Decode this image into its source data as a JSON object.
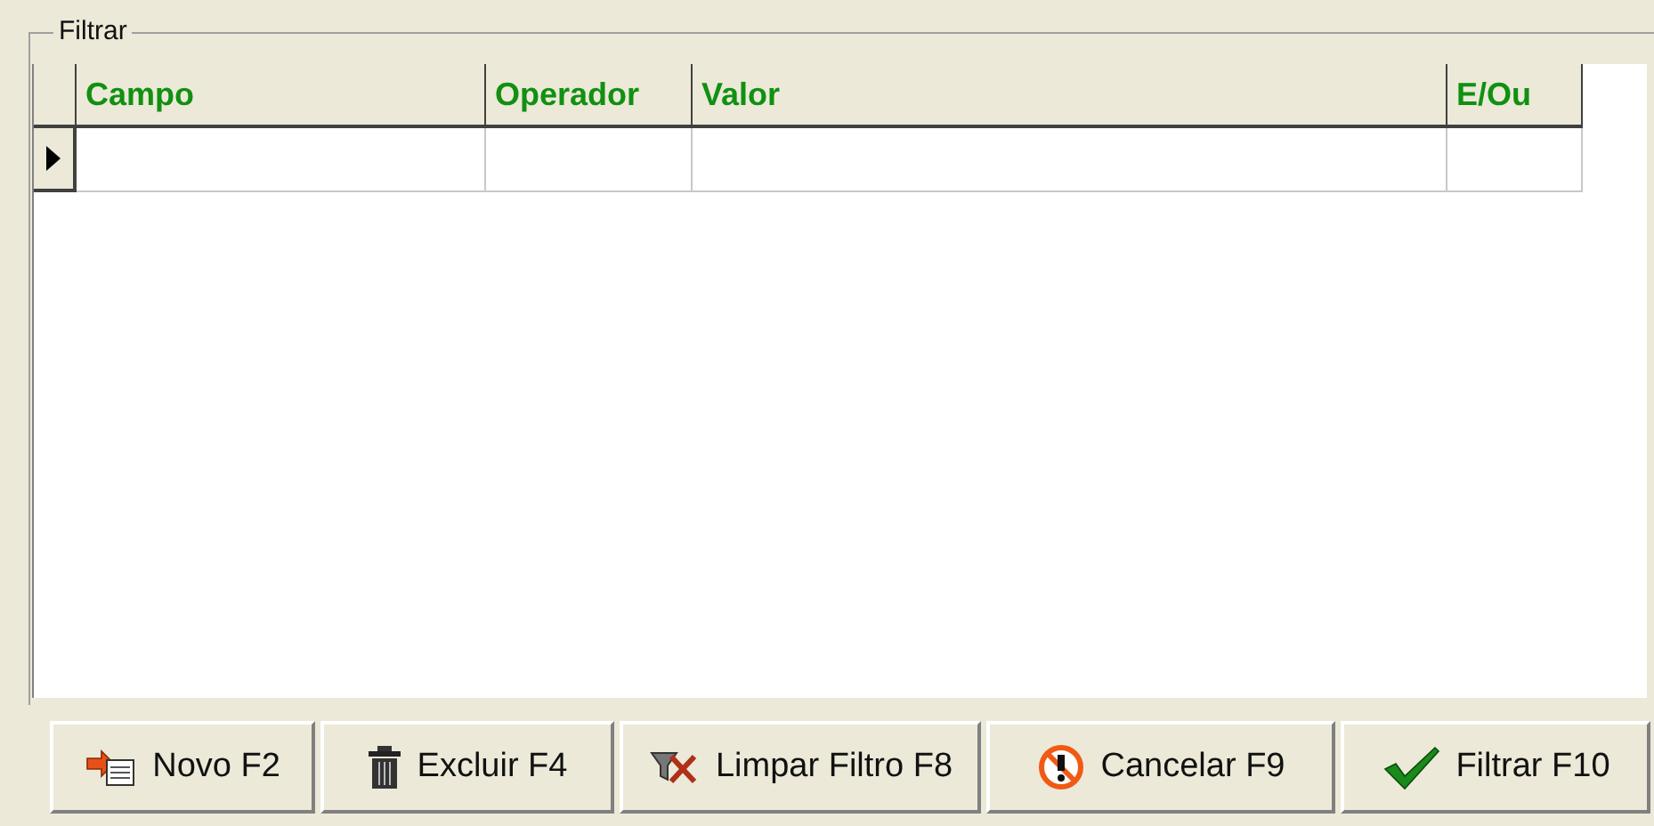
{
  "group": {
    "title": "Filtrar"
  },
  "table": {
    "columns": [
      "Campo",
      "Operador",
      "Valor",
      "E/Ou"
    ],
    "rows": [
      {
        "selected": true
      }
    ]
  },
  "buttons": [
    {
      "label": "Novo F2",
      "kind": "new"
    },
    {
      "label": "Excluir F4",
      "kind": "delete"
    },
    {
      "label": "Limpar Filtro F8",
      "kind": "clear"
    },
    {
      "label": "Cancelar F9",
      "kind": "cancel"
    },
    {
      "label": "Filtrar F10",
      "kind": "apply"
    }
  ]
}
